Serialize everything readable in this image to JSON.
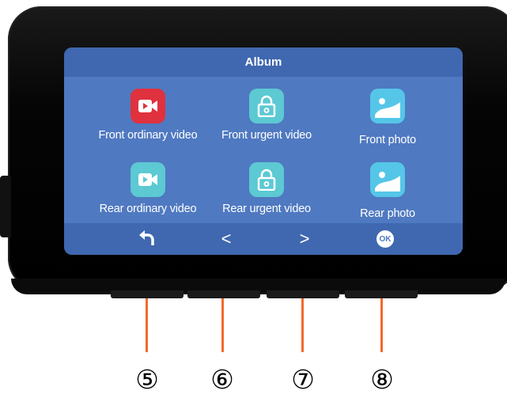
{
  "screen": {
    "title": "Album",
    "tiles": [
      {
        "label": "Front ordinary video",
        "icon": "video-camera-icon",
        "color": "#e0313e"
      },
      {
        "label": "Front urgent video",
        "icon": "lock-icon",
        "color": "#5cc9d3"
      },
      {
        "label": "Front photo",
        "icon": "photo-icon",
        "color": "#55c6e8"
      },
      {
        "label": "Rear ordinary video",
        "icon": "video-camera-icon",
        "color": "#5cc9d3"
      },
      {
        "label": "Rear urgent video",
        "icon": "lock-icon",
        "color": "#5cc9d3"
      },
      {
        "label": "Rear photo",
        "icon": "photo-icon",
        "color": "#55c6e8"
      }
    ],
    "bottom_bar": {
      "back_icon": "back-arrow-icon",
      "prev": "<",
      "next": ">",
      "ok": "OK"
    }
  },
  "callouts": [
    "⑤",
    "⑥",
    "⑦",
    "⑧"
  ],
  "colors": {
    "screen_bg": "#4f79c1",
    "bar_bg": "#3f68b0",
    "leader_line": "#f26a2b"
  }
}
